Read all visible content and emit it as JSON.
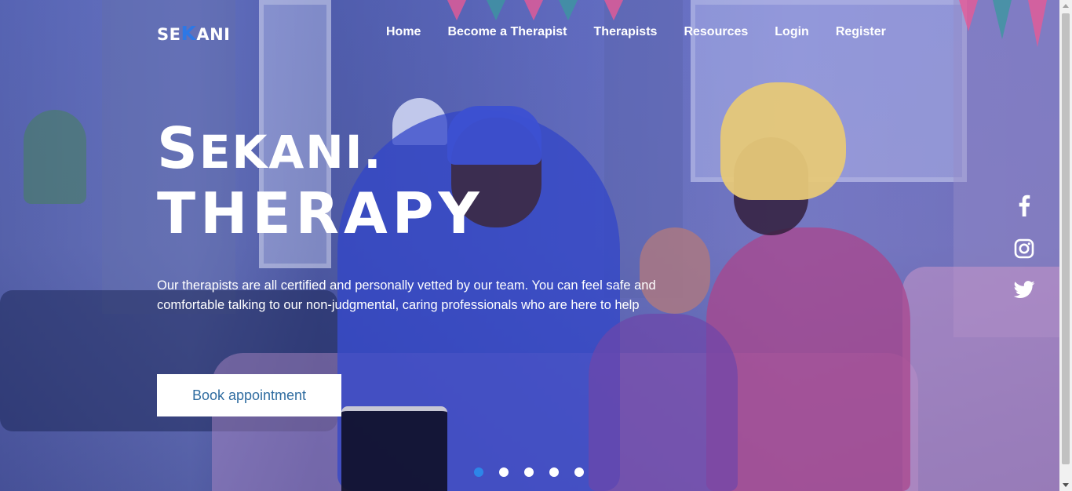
{
  "brand": {
    "prefix": "SE",
    "highlight": "K",
    "suffix": "ANI",
    "accent_color": "#2d78e6"
  },
  "nav": {
    "items": [
      {
        "label": "Home"
      },
      {
        "label": "Become a Therapist"
      },
      {
        "label": "Therapists"
      },
      {
        "label": "Resources"
      },
      {
        "label": "Login"
      },
      {
        "label": "Register"
      }
    ]
  },
  "hero": {
    "title_line1_first": "S",
    "title_line1_rest": "EKANI.",
    "title_line2": "THERAPY",
    "description": "Our therapists are all certified and personally vetted by our team. You can feel safe and comfortable talking to our non-judgmental, caring professionals who are here to help",
    "cta_label": "Book appointment",
    "cta_text_color": "#2f6ca0",
    "overlay_color": "#3f5ad0"
  },
  "social": {
    "icons": [
      "facebook-icon",
      "instagram-icon",
      "twitter-icon"
    ]
  },
  "carousel": {
    "slide_count": 5,
    "active_index": 0,
    "active_color": "#2d86e8"
  }
}
